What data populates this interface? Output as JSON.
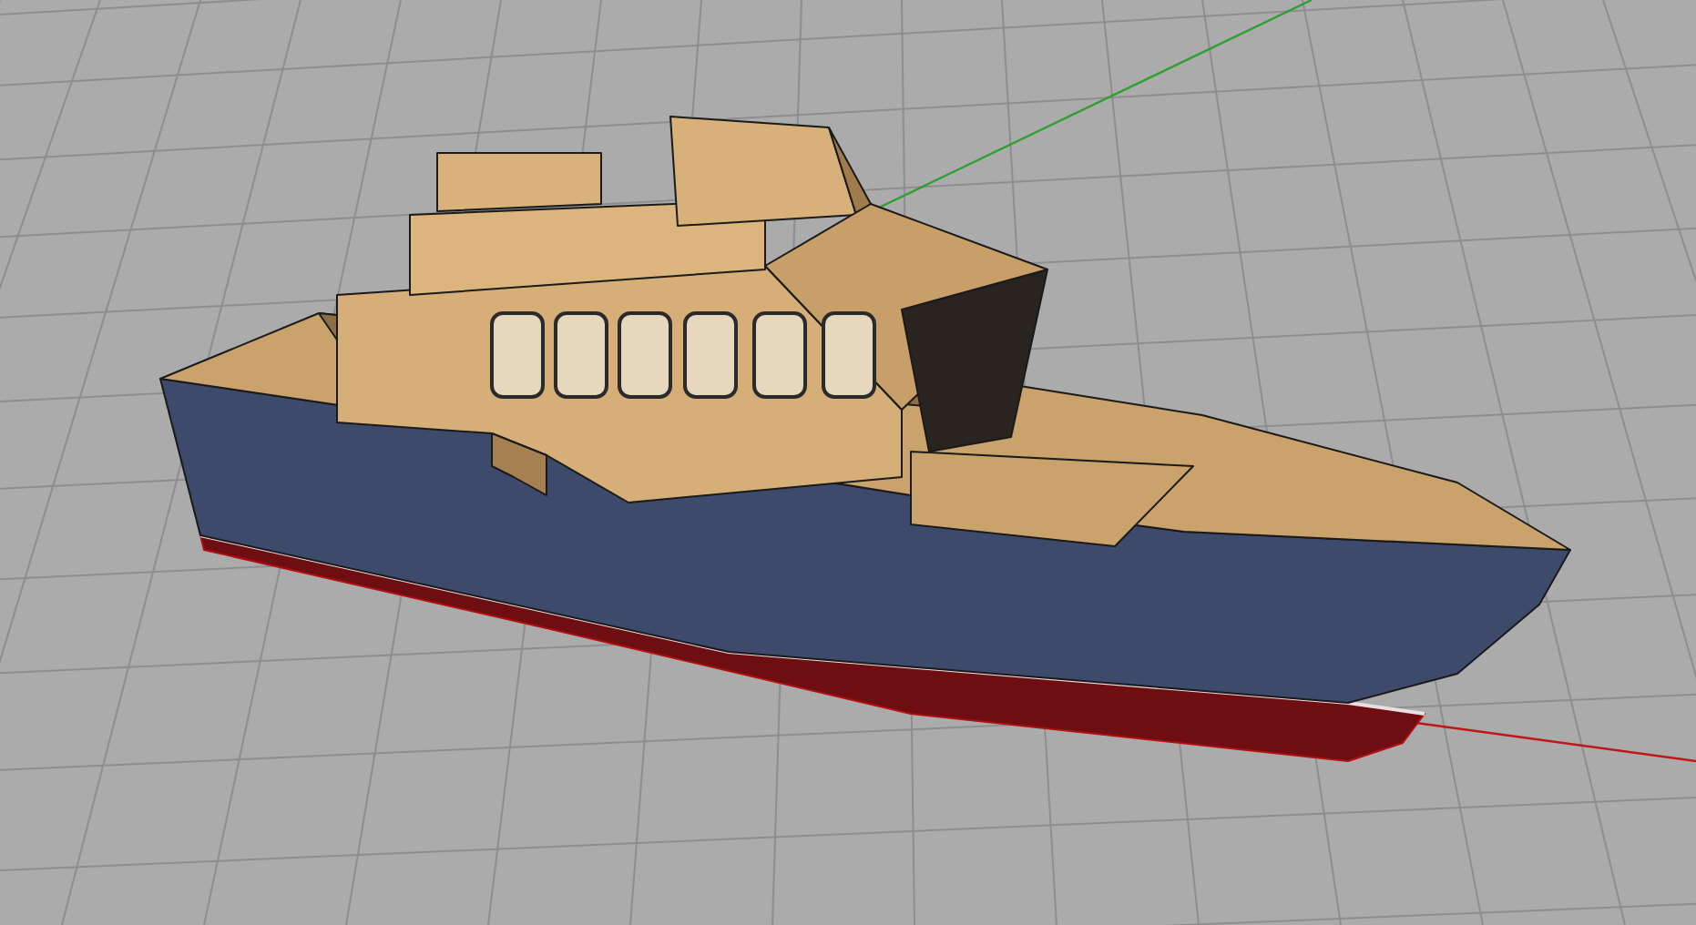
{
  "viewport": {
    "axes": [
      {
        "kind": "y",
        "color": "#2fa02f"
      },
      {
        "kind": "x",
        "color": "#c01818"
      }
    ]
  }
}
